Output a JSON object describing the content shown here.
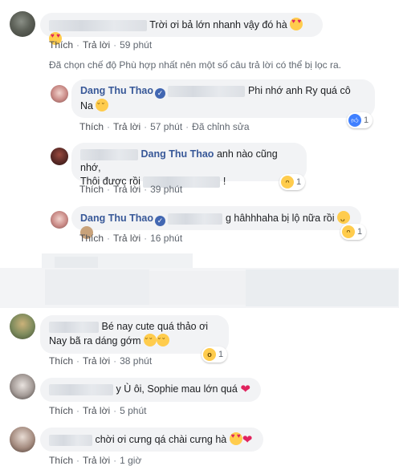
{
  "comments": [
    {
      "id": "c1",
      "text": "Trời ơi bả lớn nhanh vậy đó hà",
      "actions": {
        "like": "Thích",
        "reply": "Trả lời",
        "time": "59 phút"
      }
    },
    {
      "id": "c2",
      "author": "Dang Thu Thao",
      "text_line1": "Phi nhớ anh Ry quá cô",
      "text_line2": "Na",
      "actions": {
        "like": "Thích",
        "reply": "Trả lời",
        "time": "57 phút",
        "edited": "Đã chỉnh sửa"
      },
      "reactions": {
        "count": "1",
        "icon": "like-icon"
      }
    },
    {
      "id": "c3",
      "mention": "Dang Thu Thao",
      "text_line1": "anh nào cũng nhớ,",
      "text_line2_prefix": "Thôi được rồi",
      "text_line2_suffix": "!",
      "actions": {
        "like": "Thích",
        "reply": "Trả lời",
        "time": "39 phút"
      },
      "reactions": {
        "count": "1",
        "icon": "haha-icon"
      }
    },
    {
      "id": "c4",
      "author": "Dang Thu Thao",
      "text": "g hâhhhaha bị lộ nữa rồi",
      "actions": {
        "like": "Thích",
        "reply": "Trả lời",
        "time": "16 phút"
      },
      "reactions": {
        "count": "1",
        "icon": "haha-icon"
      }
    },
    {
      "id": "c5",
      "text_line1": "Bé nay cute quá thảo ơi",
      "text_line2": "Nay bã ra dáng gớm",
      "actions": {
        "like": "Thích",
        "reply": "Trả lời",
        "time": "38 phút"
      },
      "reactions": {
        "count": "1",
        "icon": "wow-icon"
      }
    },
    {
      "id": "c6",
      "text": "y Ù ôi, Sophie mau lớn quá",
      "actions": {
        "like": "Thích",
        "reply": "Trả lời",
        "time": "5 phút"
      }
    },
    {
      "id": "c7",
      "text": "chời ơi cưng qá chài cưng hà",
      "actions": {
        "like": "Thích",
        "reply": "Trả lời",
        "time": "1 giờ"
      }
    }
  ],
  "filter_note": "Đã chọn chế độ Phù hợp nhất nên một số câu trả lời có thể bị lọc ra.",
  "colors": {
    "name": "#385898",
    "bubble": "#f2f3f5",
    "meta": "#606770",
    "like_blue": "#4080ff",
    "emoji_yellow": "#ffcc4d",
    "heart_red": "#e0245e"
  }
}
